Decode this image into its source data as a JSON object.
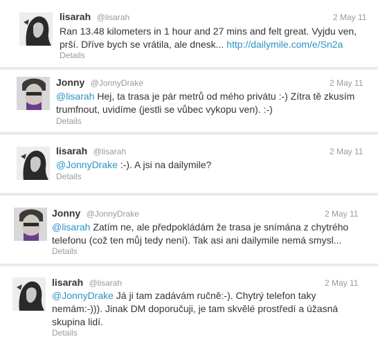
{
  "tweets": [
    {
      "name": "lisarah",
      "handle": "@lisarah",
      "date": "2 May 11",
      "text": "Ran 13.48 kilometers in 1 hour and 27 mins and felt great. Vyjdu ven, prší. Dříve bych se vrátila, ale dnesk... ",
      "link": "http://dailymile.com/e/Sn2a",
      "details": "Details"
    },
    {
      "name": "Jonny",
      "handle": "@JonnyDrake",
      "date": "2 May 11",
      "mention": "@lisarah",
      "text": " Hej, ta trasa je pár metrů od mého privátu :-) Zítra tě zkusím trumfnout, uvidíme (jestli se vůbec vykopu ven). :-)",
      "details": "Details"
    },
    {
      "name": "lisarah",
      "handle": "@lisarah",
      "date": "2 May 11",
      "mention": "@JonnyDrake",
      "text": " :-). A jsi na dailymile?",
      "details": "Details"
    },
    {
      "name": "Jonny",
      "handle": "@JonnyDrake",
      "date": "2 May 11",
      "mention": "@lisarah",
      "text": " Zatím ne, ale předpokládám že trasa je snímána z chytrého telefonu (což ten můj tedy není). Tak asi ani dailymile nemá smysl...",
      "details": "Details"
    },
    {
      "name": "lisarah",
      "handle": "@lisarah",
      "date": "2 May 11",
      "mention": "@JonnyDrake",
      "text": " Já ji tam zadávám ručně:-). Chytrý telefon taky nemám:-))). Jinak DM doporučuji, je tam skvělé prostředí a úžasná skupina lidí.",
      "details": "Details"
    }
  ]
}
